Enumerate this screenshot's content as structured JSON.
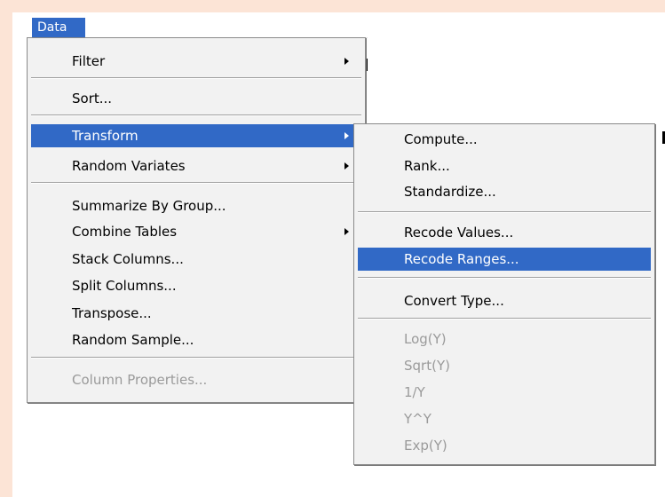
{
  "menubar": {
    "data_label": "Data"
  },
  "data_menu": {
    "items": [
      {
        "label": "Filter"
      },
      {
        "label": "Sort..."
      },
      {
        "label": "Transform"
      },
      {
        "label": "Random Variates"
      },
      {
        "label": "Summarize By Group..."
      },
      {
        "label": "Combine Tables"
      },
      {
        "label": "Stack Columns..."
      },
      {
        "label": "Split Columns..."
      },
      {
        "label": "Transpose..."
      },
      {
        "label": "Random Sample..."
      },
      {
        "label": "Column Properties..."
      }
    ]
  },
  "transform_submenu": {
    "items": [
      {
        "label": "Compute..."
      },
      {
        "label": "Rank..."
      },
      {
        "label": "Standardize..."
      },
      {
        "label": "Recode Values..."
      },
      {
        "label": "Recode Ranges..."
      },
      {
        "label": "Convert Type..."
      },
      {
        "label": "Log(Y)"
      },
      {
        "label": "Sqrt(Y)"
      },
      {
        "label": "1/Y"
      },
      {
        "label": "Y^Y"
      },
      {
        "label": "Exp(Y)"
      }
    ]
  },
  "colors": {
    "highlight": "#3169c6",
    "background": "#fce4d6",
    "menu_bg": "#f2f2f2",
    "disabled_text": "#9a9a9a"
  }
}
